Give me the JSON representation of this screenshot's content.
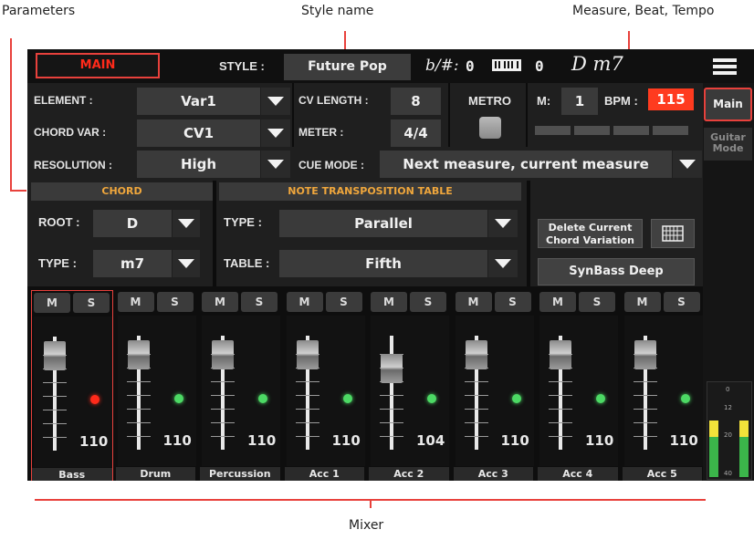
{
  "annotations": {
    "parameters": "Parameters",
    "style_name": "Style name",
    "measure_beat_tempo": "Measure, Beat, Tempo",
    "mixer": "Mixer"
  },
  "topbar": {
    "main_label": "MAIN",
    "style_label": "STYLE :",
    "style_name": "Future Pop",
    "flat_sharp": "b/#:",
    "flat_sharp_value": "0",
    "keyboard_value": "0",
    "chord": "D m7",
    "menu_icon": "hamburger-menu-icon"
  },
  "params": {
    "element_label": "ELEMENT :",
    "element_value": "Var1",
    "chord_var_label": "CHORD VAR :",
    "chord_var_value": "CV1",
    "resolution_label": "RESOLUTION :",
    "resolution_value": "High",
    "cv_length_label": "CV LENGTH :",
    "cv_length_value": "8",
    "meter_label": "METER :",
    "meter_value": "4/4",
    "metro_label": "METRO",
    "m_label": "M:",
    "m_value": "1",
    "bpm_label": "BPM :",
    "bpm_value": "115",
    "cue_mode_label": "CUE MODE :",
    "cue_mode_value": "Next measure, current measure"
  },
  "chord": {
    "header": "CHORD",
    "root_label": "ROOT :",
    "root_value": "D",
    "type_label": "TYPE :",
    "type_value": "m7"
  },
  "ntt": {
    "header": "NOTE TRANSPOSITION TABLE",
    "type_label": "TYPE :",
    "type_value": "Parallel",
    "table_label": "TABLE :",
    "table_value": "Fifth"
  },
  "actions": {
    "delete_line1": "Delete Current",
    "delete_line2": "Chord Variation",
    "sound_name": "SynBass Deep"
  },
  "side": {
    "main_tab": "Main",
    "guitar_tab_line1": "Guitar",
    "guitar_tab_line2": "Mode",
    "meter_ticks": [
      "0",
      "12",
      "20",
      "40"
    ]
  },
  "mixer": {
    "m_label": "M",
    "s_label": "S",
    "channels": [
      {
        "name": "Bass",
        "volume": "110",
        "led": "#ff2a1a"
      },
      {
        "name": "Drum",
        "volume": "110",
        "led": "#4cd964"
      },
      {
        "name": "Percussion",
        "volume": "110",
        "led": "#4cd964"
      },
      {
        "name": "Acc 1",
        "volume": "110",
        "led": "#4cd964"
      },
      {
        "name": "Acc 2",
        "volume": "104",
        "led": "#4cd964"
      },
      {
        "name": "Acc 3",
        "volume": "110",
        "led": "#4cd964"
      },
      {
        "name": "Acc 4",
        "volume": "110",
        "led": "#4cd964"
      },
      {
        "name": "Acc 5",
        "volume": "110",
        "led": "#4cd964"
      }
    ]
  },
  "colors": {
    "accent_red": "#e8413c",
    "bpm_bg": "#ff3b1f",
    "header_orange": "#f0a73c"
  }
}
